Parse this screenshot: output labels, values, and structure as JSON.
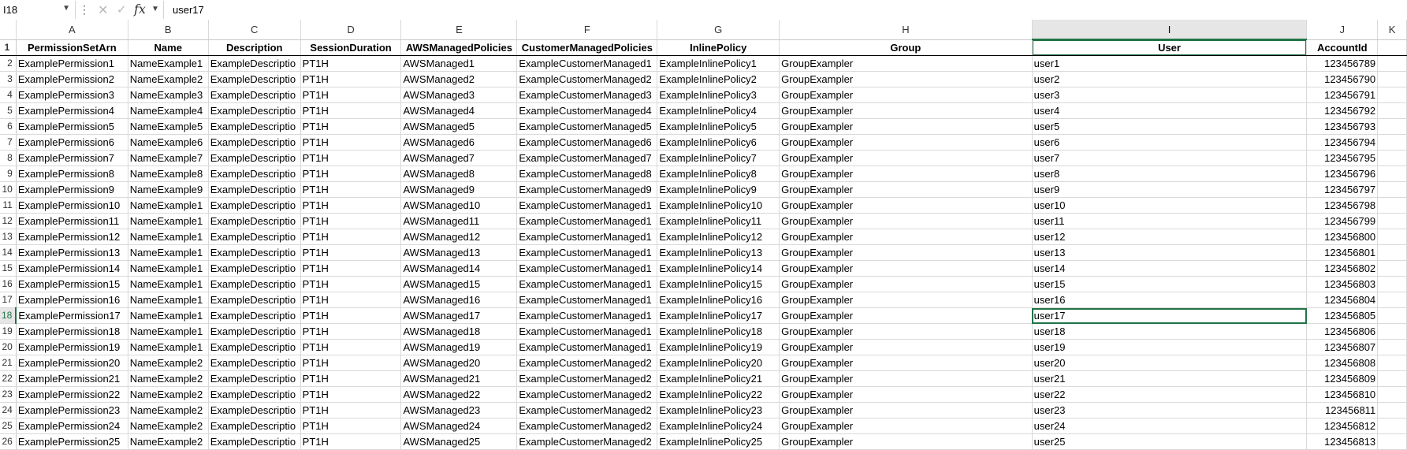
{
  "formula_bar": {
    "name_box": "I18",
    "fx_label": "fx",
    "value": "user17",
    "cancel_icon": "cancel-icon",
    "enter_icon": "check-icon"
  },
  "column_letters": [
    "A",
    "B",
    "C",
    "D",
    "E",
    "F",
    "G",
    "H",
    "I",
    "J",
    "K"
  ],
  "selected_column": "I",
  "selected_row": "18",
  "headers": [
    "PermissionSetArn",
    "Name",
    "Description",
    "SessionDuration",
    "AWSManagedPolicies",
    "CustomerManagedPolicies",
    "InlinePolicy",
    "Group",
    "User",
    "AccountId"
  ],
  "rows": [
    {
      "n": "1",
      "c": []
    },
    {
      "n": "2",
      "c": [
        "ExamplePermission1",
        "NameExample1",
        "ExampleDescriptio",
        "PT1H",
        "AWSManaged1",
        "ExampleCustomerManaged1",
        "ExampleInlinePolicy1",
        "GroupExampler",
        "user1",
        "123456789"
      ]
    },
    {
      "n": "3",
      "c": [
        "ExamplePermission2",
        "NameExample2",
        "ExampleDescriptio",
        "PT1H",
        "AWSManaged2",
        "ExampleCustomerManaged2",
        "ExampleInlinePolicy2",
        "GroupExampler",
        "user2",
        "123456790"
      ]
    },
    {
      "n": "4",
      "c": [
        "ExamplePermission3",
        "NameExample3",
        "ExampleDescriptio",
        "PT1H",
        "AWSManaged3",
        "ExampleCustomerManaged3",
        "ExampleInlinePolicy3",
        "GroupExampler",
        "user3",
        "123456791"
      ]
    },
    {
      "n": "5",
      "c": [
        "ExamplePermission4",
        "NameExample4",
        "ExampleDescriptio",
        "PT1H",
        "AWSManaged4",
        "ExampleCustomerManaged4",
        "ExampleInlinePolicy4",
        "GroupExampler",
        "user4",
        "123456792"
      ]
    },
    {
      "n": "6",
      "c": [
        "ExamplePermission5",
        "NameExample5",
        "ExampleDescriptio",
        "PT1H",
        "AWSManaged5",
        "ExampleCustomerManaged5",
        "ExampleInlinePolicy5",
        "GroupExampler",
        "user5",
        "123456793"
      ]
    },
    {
      "n": "7",
      "c": [
        "ExamplePermission6",
        "NameExample6",
        "ExampleDescriptio",
        "PT1H",
        "AWSManaged6",
        "ExampleCustomerManaged6",
        "ExampleInlinePolicy6",
        "GroupExampler",
        "user6",
        "123456794"
      ]
    },
    {
      "n": "8",
      "c": [
        "ExamplePermission7",
        "NameExample7",
        "ExampleDescriptio",
        "PT1H",
        "AWSManaged7",
        "ExampleCustomerManaged7",
        "ExampleInlinePolicy7",
        "GroupExampler",
        "user7",
        "123456795"
      ]
    },
    {
      "n": "9",
      "c": [
        "ExamplePermission8",
        "NameExample8",
        "ExampleDescriptio",
        "PT1H",
        "AWSManaged8",
        "ExampleCustomerManaged8",
        "ExampleInlinePolicy8",
        "GroupExampler",
        "user8",
        "123456796"
      ]
    },
    {
      "n": "10",
      "c": [
        "ExamplePermission9",
        "NameExample9",
        "ExampleDescriptio",
        "PT1H",
        "AWSManaged9",
        "ExampleCustomerManaged9",
        "ExampleInlinePolicy9",
        "GroupExampler",
        "user9",
        "123456797"
      ]
    },
    {
      "n": "11",
      "c": [
        "ExamplePermission10",
        "NameExample1",
        "ExampleDescriptio",
        "PT1H",
        "AWSManaged10",
        "ExampleCustomerManaged1",
        "ExampleInlinePolicy10",
        "GroupExampler",
        "user10",
        "123456798"
      ]
    },
    {
      "n": "12",
      "c": [
        "ExamplePermission11",
        "NameExample1",
        "ExampleDescriptio",
        "PT1H",
        "AWSManaged11",
        "ExampleCustomerManaged1",
        "ExampleInlinePolicy11",
        "GroupExampler",
        "user11",
        "123456799"
      ]
    },
    {
      "n": "13",
      "c": [
        "ExamplePermission12",
        "NameExample1",
        "ExampleDescriptio",
        "PT1H",
        "AWSManaged12",
        "ExampleCustomerManaged1",
        "ExampleInlinePolicy12",
        "GroupExampler",
        "user12",
        "123456800"
      ]
    },
    {
      "n": "14",
      "c": [
        "ExamplePermission13",
        "NameExample1",
        "ExampleDescriptio",
        "PT1H",
        "AWSManaged13",
        "ExampleCustomerManaged1",
        "ExampleInlinePolicy13",
        "GroupExampler",
        "user13",
        "123456801"
      ]
    },
    {
      "n": "15",
      "c": [
        "ExamplePermission14",
        "NameExample1",
        "ExampleDescriptio",
        "PT1H",
        "AWSManaged14",
        "ExampleCustomerManaged1",
        "ExampleInlinePolicy14",
        "GroupExampler",
        "user14",
        "123456802"
      ]
    },
    {
      "n": "16",
      "c": [
        "ExamplePermission15",
        "NameExample1",
        "ExampleDescriptio",
        "PT1H",
        "AWSManaged15",
        "ExampleCustomerManaged1",
        "ExampleInlinePolicy15",
        "GroupExampler",
        "user15",
        "123456803"
      ]
    },
    {
      "n": "17",
      "c": [
        "ExamplePermission16",
        "NameExample1",
        "ExampleDescriptio",
        "PT1H",
        "AWSManaged16",
        "ExampleCustomerManaged1",
        "ExampleInlinePolicy16",
        "GroupExampler",
        "user16",
        "123456804"
      ]
    },
    {
      "n": "18",
      "c": [
        "ExamplePermission17",
        "NameExample1",
        "ExampleDescriptio",
        "PT1H",
        "AWSManaged17",
        "ExampleCustomerManaged1",
        "ExampleInlinePolicy17",
        "GroupExampler",
        "user17",
        "123456805"
      ]
    },
    {
      "n": "19",
      "c": [
        "ExamplePermission18",
        "NameExample1",
        "ExampleDescriptio",
        "PT1H",
        "AWSManaged18",
        "ExampleCustomerManaged1",
        "ExampleInlinePolicy18",
        "GroupExampler",
        "user18",
        "123456806"
      ]
    },
    {
      "n": "20",
      "c": [
        "ExamplePermission19",
        "NameExample1",
        "ExampleDescriptio",
        "PT1H",
        "AWSManaged19",
        "ExampleCustomerManaged1",
        "ExampleInlinePolicy19",
        "GroupExampler",
        "user19",
        "123456807"
      ]
    },
    {
      "n": "21",
      "c": [
        "ExamplePermission20",
        "NameExample2",
        "ExampleDescriptio",
        "PT1H",
        "AWSManaged20",
        "ExampleCustomerManaged2",
        "ExampleInlinePolicy20",
        "GroupExampler",
        "user20",
        "123456808"
      ]
    },
    {
      "n": "22",
      "c": [
        "ExamplePermission21",
        "NameExample2",
        "ExampleDescriptio",
        "PT1H",
        "AWSManaged21",
        "ExampleCustomerManaged2",
        "ExampleInlinePolicy21",
        "GroupExampler",
        "user21",
        "123456809"
      ]
    },
    {
      "n": "23",
      "c": [
        "ExamplePermission22",
        "NameExample2",
        "ExampleDescriptio",
        "PT1H",
        "AWSManaged22",
        "ExampleCustomerManaged2",
        "ExampleInlinePolicy22",
        "GroupExampler",
        "user22",
        "123456810"
      ]
    },
    {
      "n": "24",
      "c": [
        "ExamplePermission23",
        "NameExample2",
        "ExampleDescriptio",
        "PT1H",
        "AWSManaged23",
        "ExampleCustomerManaged2",
        "ExampleInlinePolicy23",
        "GroupExampler",
        "user23",
        "123456811"
      ]
    },
    {
      "n": "25",
      "c": [
        "ExamplePermission24",
        "NameExample2",
        "ExampleDescriptio",
        "PT1H",
        "AWSManaged24",
        "ExampleCustomerManaged2",
        "ExampleInlinePolicy24",
        "GroupExampler",
        "user24",
        "123456812"
      ]
    },
    {
      "n": "26",
      "c": [
        "ExamplePermission25",
        "NameExample2",
        "ExampleDescriptio",
        "PT1H",
        "AWSManaged25",
        "ExampleCustomerManaged2",
        "ExampleInlinePolicy25",
        "GroupExampler",
        "user25",
        "123456813"
      ]
    }
  ]
}
